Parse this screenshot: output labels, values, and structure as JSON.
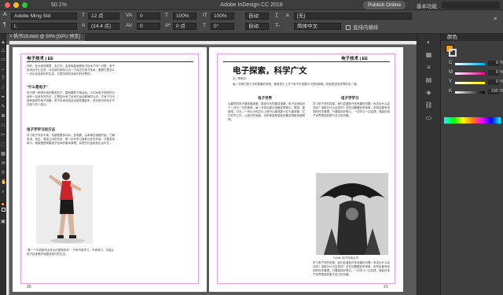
{
  "app": {
    "title": "Adobe InDesign CC 2018",
    "zoom": "50.1%",
    "publish_label": "Publish Online",
    "workspace": "基本功能"
  },
  "control": {
    "font_family": "Adobe Ming Std",
    "font_style": "L",
    "font_size": "12 点",
    "leading": "(14.4 点)",
    "tracking": "0",
    "kerning": "0",
    "scale_h": "100%",
    "scale_v": "100%",
    "baseline": "0 点",
    "skew": "0°",
    "auto1": "自动",
    "auto2": "自动",
    "char_style": "[无]",
    "language": "简体中文",
    "direct_label": "直排内横排"
  },
  "doc_tab": "帆书18.indd @ 50% [GPU 预览]",
  "left_page": {
    "header": "电子技术 | EE",
    "intro": "你好，在大家的眼里，会打字、会用电脑就是电子技术了吗？可是，电子技术远不止这些。今天我们就来认识一下真正的电子技术，看看它是怎么一步步走进我们的生活，又是怎样改变我们的世界的。",
    "sub1": "\"什么是电子\"",
    "para1": "电子是一种带负电的基本粒子，围绕着原子核运动。人们对电子的研究已经有一百多年的历史，正是因为有了对电子运动规律的认识，才有了今天各种各样的电子设备，电子技术也因此迅速发展起来，成为现代科技中不可缺少的一部分。",
    "sub2": "电子学学习的方法",
    "para2": "学习电子学并不难，关键是要多动手、多观察。从简单的电路开始，了解电流、电压、电阻之间的关系，再一步步学习各种元件的作用。只要坚持练习，就能慢慢掌握电子技术的基本原理，并把它们运用到生活中去。",
    "caption": "\"第一个手机制作出来大约是很多年\"，只有不断学习，不停努力，才能让电子技术更好地服务我们的生活。",
    "page_number": "20"
  },
  "right_page": {
    "header": "电子技术 | EE",
    "title": "电子探索，科学广文",
    "byline": "文 / 李明宇",
    "intro": "每一次我们按下手机屏幕的按钮，都有成千上万个电子在电路中飞快地奔跑，把信息送到世界的另一端。",
    "col1_head": "电子世界",
    "col1": "从最早的电子管到晶体管，再到今天的集成电路，电子技术经历了一次又一次的革命。每一次变化都让设备变得更小、更快、更省电。今天，一块小小的芯片上就可以集成数十亿个晶体管，它们共同工作，让我们的电脑、手机和各种智能设备变得越来越聪明。",
    "col2_head": "电子学学习",
    "col2": "学习电子学的时候，我们会遇到许多有趣的问题：电流为什么会流动？电阻为什么会发热？这些问题看起来简单，但背后都有深刻的科学道理。只要保持好奇心，一边学习一边实践，就能在电子世界里找到属于自己的乐趣。",
    "caption": "Credit: 电子探索丛书",
    "page_number": "21"
  },
  "panel": {
    "title": "颜色",
    "channels": [
      {
        "name": "C",
        "value": "0"
      },
      {
        "name": "M",
        "value": "0"
      },
      {
        "name": "Y",
        "value": "0"
      },
      {
        "name": "K",
        "value": "100"
      }
    ]
  },
  "colors": {
    "accent": "#f29b1d",
    "frame": "#e59be6",
    "column": "#8c8cf0"
  }
}
